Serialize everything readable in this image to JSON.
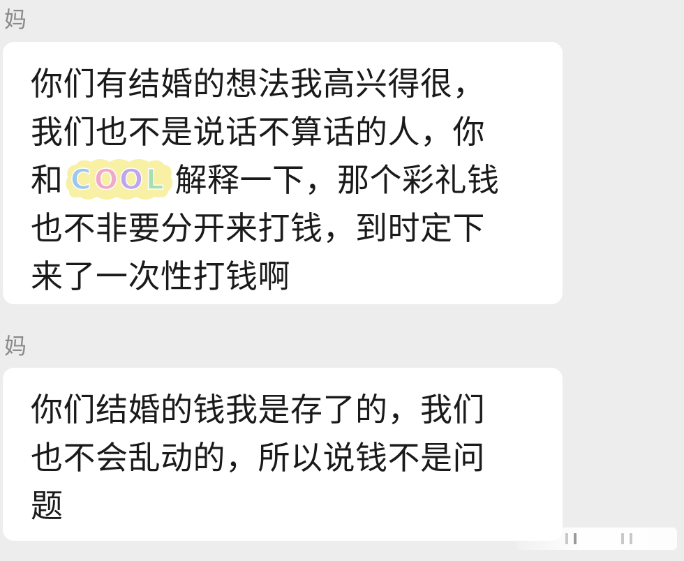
{
  "messages": [
    {
      "sender": "妈",
      "lines": [
        "你们有结婚的想法我高兴得很，",
        "我们也不是说话不算话的人，你",
        "解释一下，那个彩礼钱",
        "也不非要分开来打钱，到时定下",
        "来了一次性打钱啊"
      ],
      "line3_prefix": "和",
      "sticker": {
        "text": "COOL",
        "icon": "cool-sticker-icon",
        "letter_colors": [
          "#9ec7ee",
          "#f2a9c9",
          "#bfa6ea",
          "#a9dfb0"
        ],
        "glow_color": "#f7efa0"
      }
    },
    {
      "sender": "妈",
      "lines": [
        "你们结婚的钱我是存了的，我们",
        "也不会乱动的，所以说钱不是问",
        "题"
      ]
    }
  ],
  "colors": {
    "background": "#ededed",
    "bubble": "#ffffff",
    "text": "#1a1a1a",
    "sender": "#8a8a8a"
  }
}
